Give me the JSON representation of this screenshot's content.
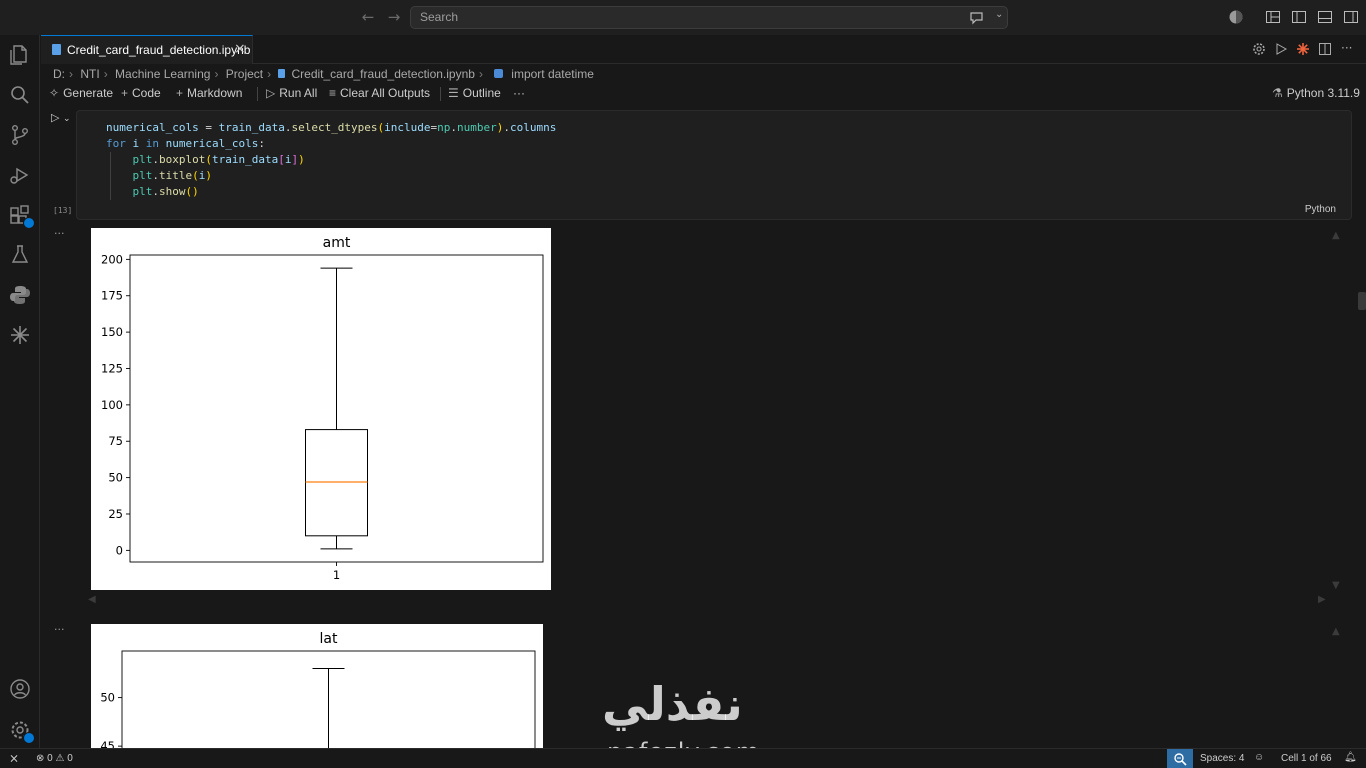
{
  "titlebar": {
    "search_placeholder": "Search",
    "back_icon": "arrow-left-icon",
    "forward_icon": "arrow-right-icon"
  },
  "activitybar": {
    "items": [
      "explorer-icon",
      "search-icon",
      "source-control-icon",
      "run-debug-icon",
      "extensions-icon",
      "testing-icon",
      "python-icon",
      "copilot-icon"
    ],
    "bottom": [
      "account-icon",
      "settings-gear-icon"
    ]
  },
  "tab": {
    "label": "Credit_card_fraud_detection.ipynb",
    "close": "×"
  },
  "breadcrumb": [
    "D:",
    "NTI",
    "Machine Learning",
    "Project",
    "Credit_card_fraud_detection.ipynb",
    "import datetime"
  ],
  "toolbar": {
    "generate": "Generate",
    "code": "Code",
    "markdown": "Markdown",
    "run_all": "Run All",
    "clear_outputs": "Clear All Outputs",
    "outline": "Outline",
    "more": "···",
    "kernel": "Python 3.11.9"
  },
  "cell": {
    "execution_count": "[13]",
    "language": "Python",
    "lines": [
      "numerical_cols = train_data.select_dtypes(include=np.number).columns",
      "for i in numerical_cols:",
      "    plt.boxplot(train_data[i])",
      "    plt.title(i)",
      "    plt.show()"
    ]
  },
  "outputs": {
    "dots": "···"
  },
  "chart_data": [
    {
      "type": "boxplot",
      "title": "amt",
      "categories": [
        "1"
      ],
      "ylim": [
        -8,
        203
      ],
      "yticks": [
        0,
        25,
        50,
        75,
        100,
        125,
        150,
        175,
        200
      ],
      "box": {
        "whisker_low": 1,
        "q1": 10,
        "median": 47,
        "q3": 83,
        "whisker_high": 194
      },
      "colors": {
        "median": "#ff7f0e",
        "box": "#000000"
      },
      "grid": false
    },
    {
      "type": "boxplot",
      "title": "lat",
      "yticks": [
        45,
        50
      ],
      "box": {
        "whisker_high": 53
      },
      "colors": {
        "box": "#000000"
      },
      "grid": false
    }
  ],
  "statusbar": {
    "errors": "0",
    "warnings": "0",
    "spaces": "Spaces: 4",
    "cell_position": "Cell 1 of 66"
  },
  "watermark": {
    "arabic": "نفذلي",
    "latin": "nafezly.com"
  }
}
